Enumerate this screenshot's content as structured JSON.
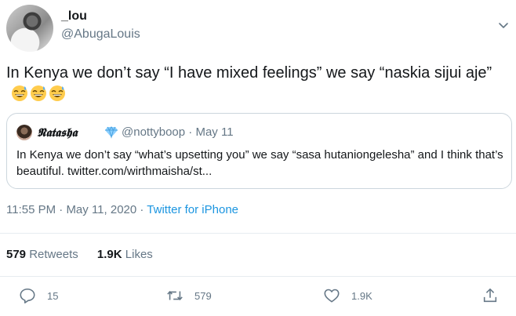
{
  "author": {
    "display_name": "_lou",
    "handle": "@AbugaLouis"
  },
  "tweet": {
    "text": "In Kenya we don’t say “I have mixed feelings” we say “naskia sijui aje”",
    "emojis": [
      "grinning-face-with-sweat",
      "grinning-face-with-sweat",
      "grinning-face-with-sweat"
    ]
  },
  "quoted_tweet": {
    "display_name": "𝕹𝖆𝖙𝖆𝖘𝖍𝖆",
    "badge_icon": "gem-stone-emoji",
    "handle": "@nottyboop",
    "separator": "·",
    "date": "May 11",
    "text": "In Kenya we don’t say “what’s upsetting you” we say “sasa hutaniongelesha” and I think that’s beautiful. twitter.com/wirthmaisha/st..."
  },
  "meta": {
    "time": "11:55 PM",
    "sep1": "·",
    "date": "May 11, 2020",
    "sep2": "·",
    "source": "Twitter for iPhone"
  },
  "stats": {
    "retweets_count": "579",
    "retweets_label": "Retweets",
    "likes_count": "1.9K",
    "likes_label": "Likes"
  },
  "actions": {
    "reply_count": "15",
    "retweet_count": "579",
    "like_count": "1.9K"
  },
  "colors": {
    "text": "#14171a",
    "secondary": "#657786",
    "link": "#1b95e0",
    "border": "#ccd6dd"
  }
}
